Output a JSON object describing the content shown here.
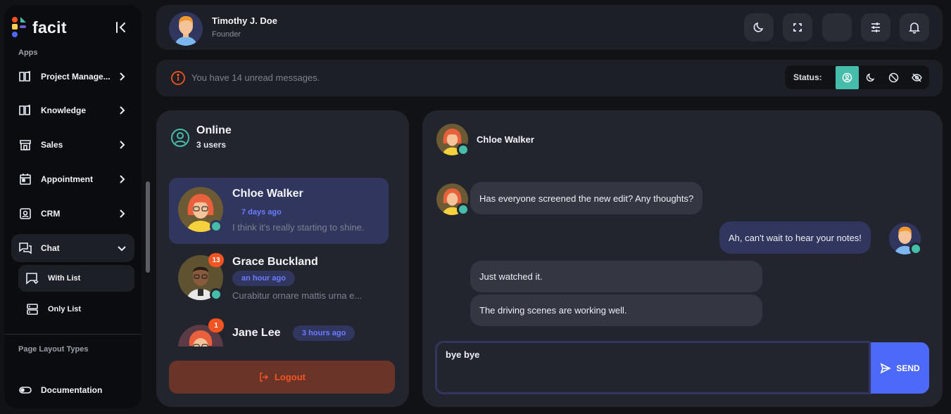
{
  "brand": {
    "name": "facit"
  },
  "sidebar": {
    "apps_label": "Apps",
    "items": [
      {
        "label": "Project Manage..."
      },
      {
        "label": "Knowledge"
      },
      {
        "label": "Sales"
      },
      {
        "label": "Appointment"
      },
      {
        "label": "CRM"
      },
      {
        "label": "Chat"
      }
    ],
    "chat_sub": [
      {
        "label": "With List"
      },
      {
        "label": "Only List"
      }
    ],
    "page_layout_label": "Page Layout Types",
    "documentation_label": "Documentation"
  },
  "header": {
    "user_name": "Timothy J. Doe",
    "user_role": "Founder"
  },
  "alert": {
    "text": "You have 14 unread messages.",
    "status_label": "Status:"
  },
  "online": {
    "title": "Online",
    "count": "3 users",
    "contacts": [
      {
        "name": "Chloe Walker",
        "time": "7 days ago",
        "message": "I think it's really starting to shine."
      },
      {
        "name": "Grace Buckland",
        "time": "an hour ago",
        "message": "Curabitur ornare mattis urna e...",
        "badge": "13"
      },
      {
        "name": "Jane Lee",
        "time": "3 hours ago",
        "message": "",
        "badge": "1"
      }
    ],
    "logout_label": "Logout"
  },
  "chat": {
    "partner_name": "Chloe Walker",
    "messages": [
      {
        "from": "partner",
        "text": "Has everyone screened the new edit? Any thoughts?"
      },
      {
        "from": "me",
        "text": "Ah, can't wait to hear your notes!"
      },
      {
        "from": "partner",
        "text": "Just watched it."
      },
      {
        "from": "partner",
        "text": "The driving scenes are working well."
      }
    ],
    "input_value": "bye bye",
    "send_label": "SEND"
  },
  "colors": {
    "accent": "#4d69fa",
    "online_green": "#46bcaa",
    "danger": "#f35421",
    "selected_bg": "#30365e"
  }
}
